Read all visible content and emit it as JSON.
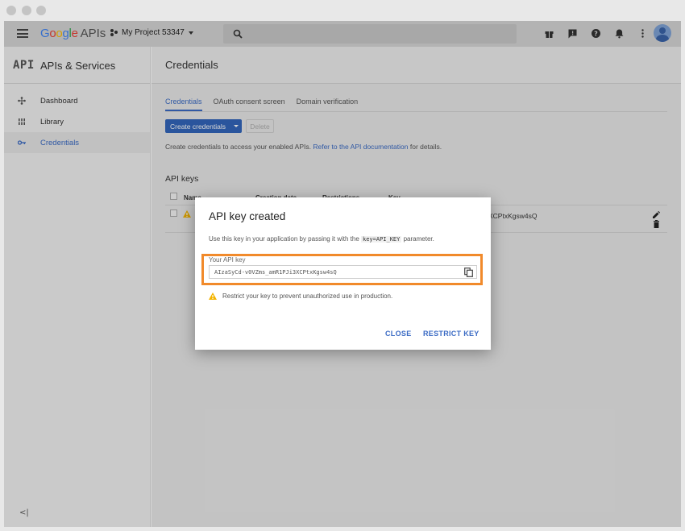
{
  "topbar": {
    "logo_google": "Google",
    "logo_apis": "APIs",
    "project_name": "My Project 53347"
  },
  "sidebar": {
    "title": "APIs & Services",
    "api_mark": "API",
    "items": [
      {
        "label": "Dashboard",
        "icon": "dashboard-icon"
      },
      {
        "label": "Library",
        "icon": "library-icon"
      },
      {
        "label": "Credentials",
        "icon": "key-icon",
        "active": true
      }
    ],
    "collapse_label": "<|"
  },
  "main": {
    "title": "Credentials",
    "tabs": [
      {
        "label": "Credentials",
        "active": true
      },
      {
        "label": "OAuth consent screen"
      },
      {
        "label": "Domain verification"
      }
    ],
    "create_button": "Create credentials",
    "delete_button": "Delete",
    "info_text": "Create credentials to access your enabled APIs.",
    "info_link": "Refer to the API documentation",
    "info_suffix": "for details.",
    "section_title": "API keys",
    "table": {
      "headers": [
        "Name",
        "Creation date",
        "Restrictions",
        "Key"
      ],
      "row_key_tail": "XCPtxKgsw4sQ"
    }
  },
  "dialog": {
    "title": "API key created",
    "desc_prefix": "Use this key in your application by passing it with the",
    "desc_code": "key=API_KEY",
    "desc_suffix": "parameter.",
    "field_label": "Your API key",
    "api_key": "AIzaSyCd-v0VZms_amR1PJi3XCPtxKgsw4sQ",
    "warning": "Restrict your key to prevent unauthorized use in production.",
    "close_button": "CLOSE",
    "restrict_button": "RESTRICT KEY"
  },
  "colors": {
    "accent": "#3b6bc4",
    "highlight": "#f18a2b",
    "warning": "#f4b400"
  }
}
